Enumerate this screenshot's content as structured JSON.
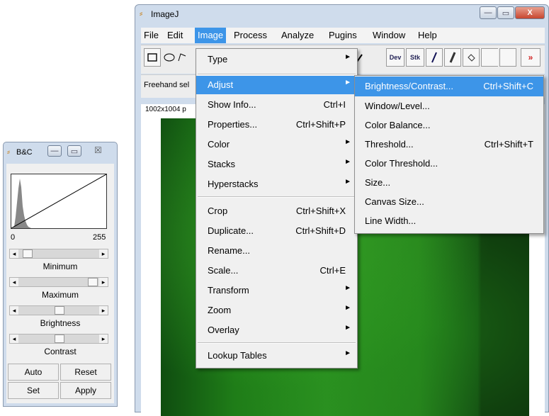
{
  "main_window": {
    "title": "ImageJ",
    "controls": {
      "minimize": "—",
      "maximize": "▭",
      "close": "X"
    },
    "menubar": [
      "File",
      "Edit",
      "Image",
      "Process",
      "Analyze",
      "Pugins",
      "Window",
      "Help"
    ],
    "toolbar": {
      "dev": "Dev",
      "stk": "Stk",
      "more": "»"
    },
    "status_text": "Freehand sel",
    "image_info": "1002x1004 p"
  },
  "image_menu": [
    {
      "label": "Type",
      "shortcut": "",
      "submenu": true
    },
    {
      "label": "Adjust",
      "shortcut": "",
      "submenu": true,
      "highlighted": true
    },
    {
      "label": "Show Info...",
      "shortcut": "Ctrl+I",
      "submenu": false
    },
    {
      "label": "Properties...",
      "shortcut": "Ctrl+Shift+P",
      "submenu": false
    },
    {
      "label": "Color",
      "shortcut": "",
      "submenu": true
    },
    {
      "label": "Stacks",
      "shortcut": "",
      "submenu": true
    },
    {
      "label": "Hyperstacks",
      "shortcut": "",
      "submenu": true
    },
    {
      "label": "Crop",
      "shortcut": "Ctrl+Shift+X",
      "submenu": false
    },
    {
      "label": "Duplicate...",
      "shortcut": "Ctrl+Shift+D",
      "submenu": false
    },
    {
      "label": "Rename...",
      "shortcut": "",
      "submenu": false
    },
    {
      "label": "Scale...",
      "shortcut": "Ctrl+E",
      "submenu": false
    },
    {
      "label": "Transform",
      "shortcut": "",
      "submenu": true
    },
    {
      "label": "Zoom",
      "shortcut": "",
      "submenu": true
    },
    {
      "label": "Overlay",
      "shortcut": "",
      "submenu": true
    },
    {
      "label": "Lookup Tables",
      "shortcut": "",
      "submenu": true
    }
  ],
  "adjust_menu": [
    {
      "label": "Brightness/Contrast...",
      "shortcut": "Ctrl+Shift+C",
      "highlighted": true
    },
    {
      "label": "Window/Level...",
      "shortcut": ""
    },
    {
      "label": "Color Balance...",
      "shortcut": ""
    },
    {
      "label": "Threshold...",
      "shortcut": "Ctrl+Shift+T"
    },
    {
      "label": "Color Threshold...",
      "shortcut": ""
    },
    {
      "label": "Size...",
      "shortcut": ""
    },
    {
      "label": "Canvas Size...",
      "shortcut": ""
    },
    {
      "label": "Line Width...",
      "shortcut": ""
    }
  ],
  "bc_window": {
    "title": "B&C",
    "hist_min": "0",
    "hist_max": "255",
    "sliders": [
      {
        "label": "Minimum",
        "position": 0.08
      },
      {
        "label": "Maximum",
        "position": 0.92
      },
      {
        "label": "Brightness",
        "position": 0.5
      },
      {
        "label": "Contrast",
        "position": 0.5
      }
    ],
    "buttons": {
      "auto": "Auto",
      "reset": "Reset",
      "set": "Set",
      "apply": "Apply"
    }
  },
  "colors": {
    "highlight": "#3d95e8",
    "image_green": "#2a8f20"
  }
}
